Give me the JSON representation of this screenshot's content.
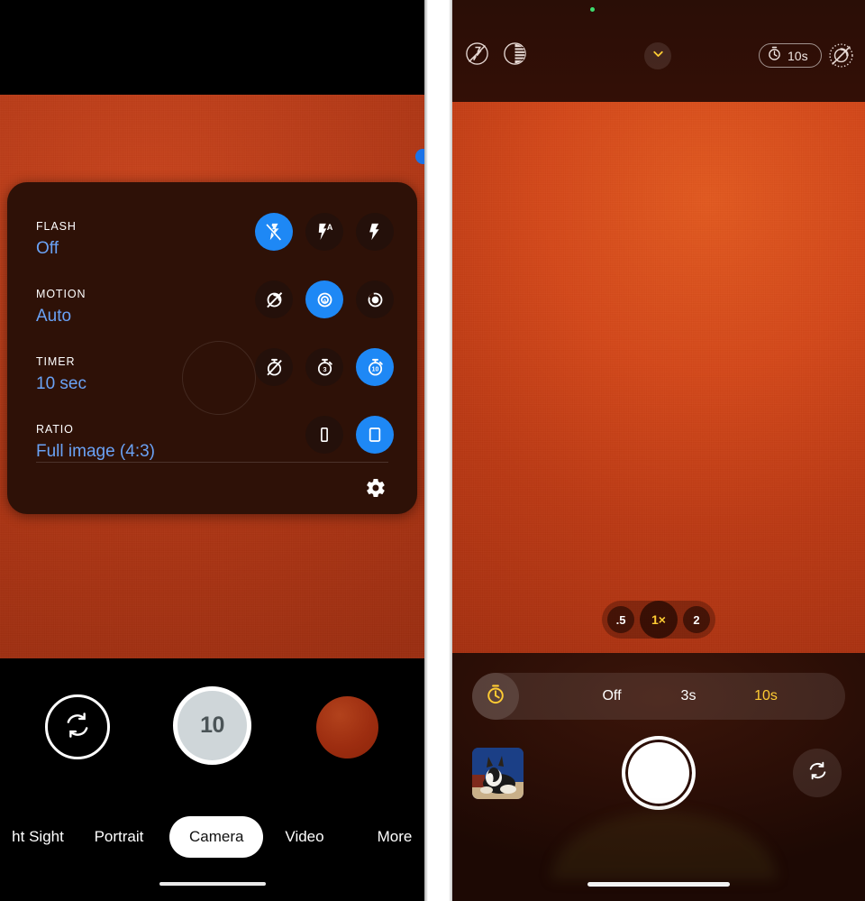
{
  "colors": {
    "accent_blue": "#1e88f5",
    "value_blue": "#6aa2f5",
    "accent_yellow": "#ffcc33",
    "sheet_bg": "#2e1107",
    "viewfinder_orange": "#c8441c",
    "green_privacy_dot": "#3ddc6e"
  },
  "left_phone": {
    "settings_sheet": {
      "rows": [
        {
          "label": "FLASH",
          "value": "Off",
          "options": [
            {
              "icon": "flash-off-icon",
              "selected": true
            },
            {
              "icon": "flash-auto-icon",
              "selected": false
            },
            {
              "icon": "flash-on-icon",
              "selected": false
            }
          ]
        },
        {
          "label": "MOTION",
          "value": "Auto",
          "options": [
            {
              "icon": "motion-off-icon",
              "selected": false
            },
            {
              "icon": "motion-auto-icon",
              "selected": true
            },
            {
              "icon": "motion-on-icon",
              "selected": false
            }
          ]
        },
        {
          "label": "TIMER",
          "value": "10 sec",
          "options": [
            {
              "icon": "timer-off-icon",
              "selected": false
            },
            {
              "icon": "timer-3s-icon",
              "selected": false,
              "badge": "3"
            },
            {
              "icon": "timer-10s-icon",
              "selected": true,
              "badge": "10"
            }
          ]
        },
        {
          "label": "RATIO",
          "value": "Full image (4:3)",
          "options": [
            {
              "icon": "ratio-16-9-icon",
              "selected": false
            },
            {
              "icon": "ratio-4-3-icon",
              "selected": true
            }
          ]
        }
      ],
      "settings_gear": "gear-icon"
    },
    "bottom_controls": {
      "lens_switch_icon": "flip-camera-icon",
      "shutter_countdown": "10",
      "gallery_thumb": "gallery-thumbnail"
    },
    "mode_strip": {
      "modes": [
        {
          "label": "ht Sight",
          "selected": false
        },
        {
          "label": "Portrait",
          "selected": false
        },
        {
          "label": "Camera",
          "selected": true
        },
        {
          "label": "Video",
          "selected": false
        },
        {
          "label": "More",
          "selected": false
        }
      ]
    }
  },
  "right_phone": {
    "top_bar": {
      "left_icons": [
        {
          "name": "flash-off-icon"
        },
        {
          "name": "top-shot-icon"
        }
      ],
      "expand_icon": "chevron-down-icon",
      "timer_badge": {
        "icon": "timer-icon",
        "label": "10s"
      },
      "motion_off_icon": "motion-off-icon"
    },
    "viewfinder": {
      "zoom_options": [
        {
          "label": ".5",
          "selected": false
        },
        {
          "label": "1×",
          "selected": true
        },
        {
          "label": "2",
          "selected": false
        }
      ]
    },
    "timer_bar": {
      "icon": "timer-icon",
      "options": [
        {
          "label": "Off",
          "selected": false
        },
        {
          "label": "3s",
          "selected": false
        },
        {
          "label": "10s",
          "selected": true
        }
      ]
    },
    "bottom_controls": {
      "gallery_thumb": "rabbit-photo-thumbnail",
      "shutter_button": "shutter-button",
      "flip_camera_icon": "flip-camera-icon"
    }
  }
}
